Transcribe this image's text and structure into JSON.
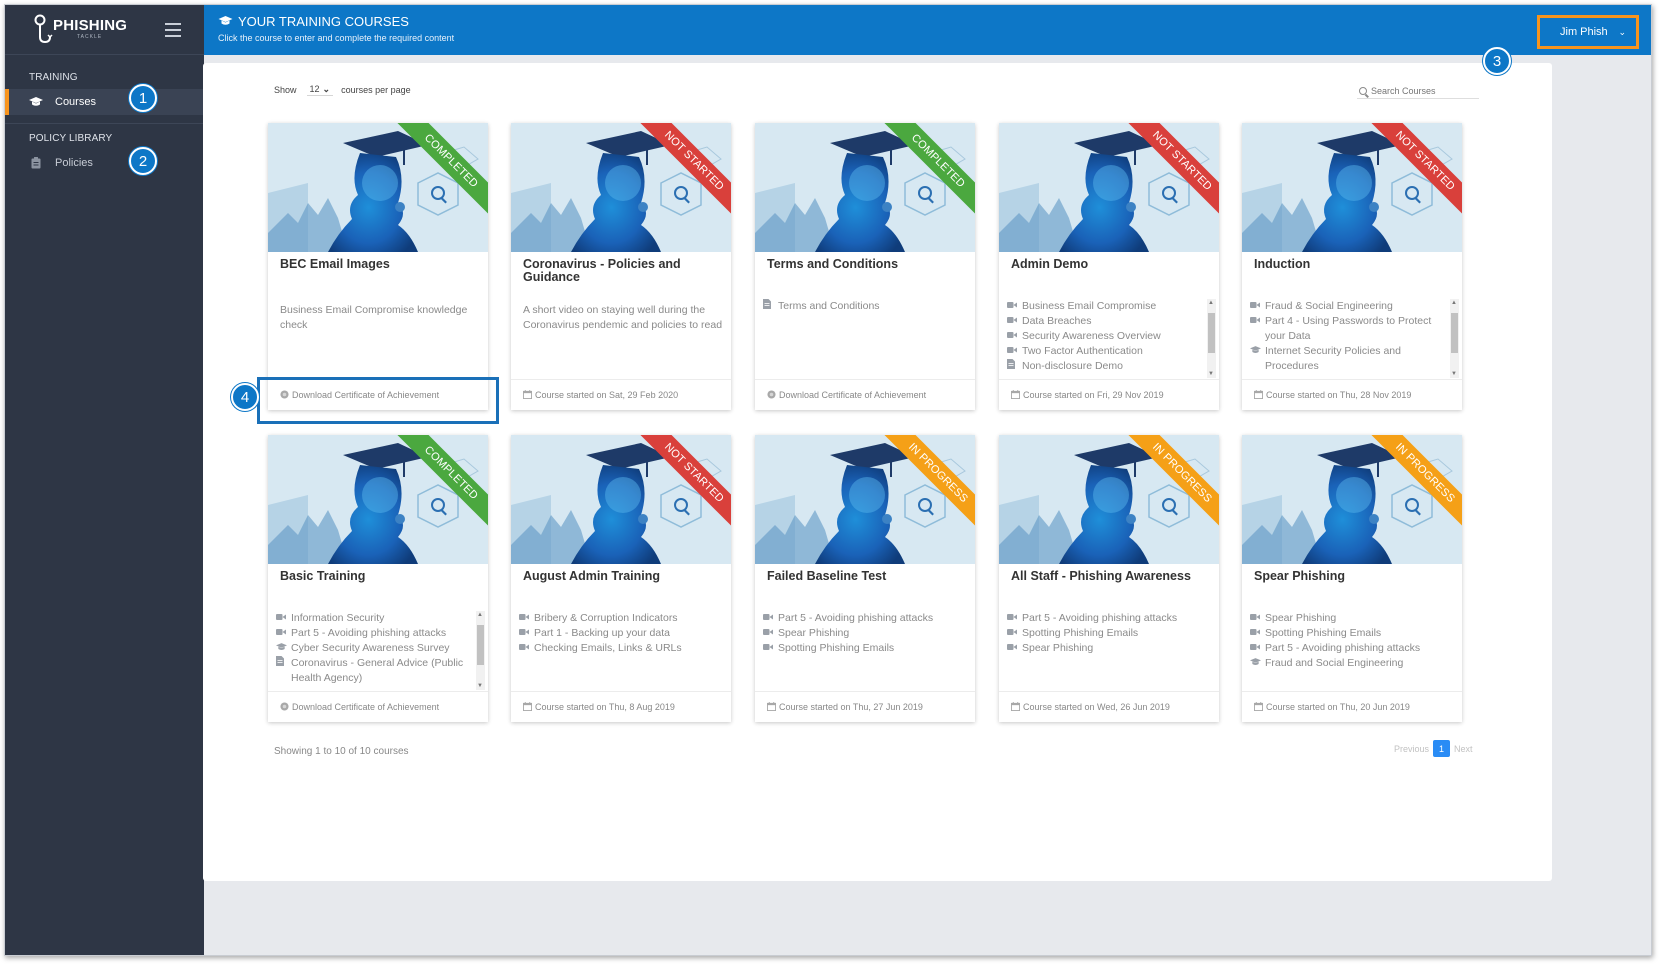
{
  "app": {
    "logo_text": "PHISHING",
    "logo_sub": "TACKLE"
  },
  "sidebar": {
    "sections": [
      {
        "label": "TRAINING",
        "items": [
          {
            "label": "Courses",
            "icon": "graduation-cap-icon",
            "active": true
          }
        ]
      },
      {
        "label": "POLICY LIBRARY",
        "items": [
          {
            "label": "Policies",
            "icon": "clipboard-icon",
            "active": false
          }
        ]
      }
    ]
  },
  "header": {
    "title": "YOUR TRAINING COURSES",
    "subtitle": "Click the course to enter and complete the required content",
    "user": "Jim Phish"
  },
  "callouts": [
    "1",
    "2",
    "3",
    "4"
  ],
  "toolbar": {
    "show_label": "Show",
    "per_page_value": "12",
    "per_page_suffix": "courses per page",
    "search_placeholder": "Search Courses"
  },
  "colors": {
    "completed": "#4ba83f",
    "not_started": "#d9403b",
    "in_progress": "#f5a017",
    "accent": "#0d77c7",
    "sidebar": "#2e3645"
  },
  "courses": [
    {
      "title": "BEC Email Images",
      "status": "COMPLETED",
      "description": "Business Email Compromise knowledge check",
      "items": [],
      "footer": "Download Certificate of Achievement",
      "footer_icon": "award-icon",
      "scroll": false
    },
    {
      "title": "Coronavirus - Policies and Guidance",
      "status": "NOT STARTED",
      "description": "A short video on staying well during the Coronavirus pendemic and policies to read",
      "items": [],
      "footer": "Course started on Sat, 29 Feb 2020",
      "footer_icon": "calendar-icon",
      "scroll": false
    },
    {
      "title": "Terms and Conditions",
      "status": "COMPLETED",
      "description": "",
      "items": [
        {
          "icon": "document-icon",
          "text": "Terms and Conditions"
        }
      ],
      "footer": "Download Certificate of Achievement",
      "footer_icon": "award-icon",
      "scroll": false
    },
    {
      "title": "Admin Demo",
      "status": "NOT STARTED",
      "description": "",
      "items": [
        {
          "icon": "video-icon",
          "text": "Business Email Compromise"
        },
        {
          "icon": "video-icon",
          "text": "Data Breaches"
        },
        {
          "icon": "video-icon",
          "text": "Security Awareness Overview"
        },
        {
          "icon": "video-icon",
          "text": "Two Factor Authentication"
        },
        {
          "icon": "document-icon",
          "text": "Non-disclosure Demo"
        }
      ],
      "footer": "Course started on Fri, 29 Nov 2019",
      "footer_icon": "calendar-icon",
      "scroll": true
    },
    {
      "title": "Induction",
      "status": "NOT STARTED",
      "description": "",
      "items": [
        {
          "icon": "video-icon",
          "text": "Fraud & Social Engineering"
        },
        {
          "icon": "video-icon",
          "text": "Part 4 - Using Passwords to Protect your Data"
        },
        {
          "icon": "graduation-cap-icon",
          "text": "Internet Security Policies and Procedures"
        }
      ],
      "footer": "Course started on Thu, 28 Nov 2019",
      "footer_icon": "calendar-icon",
      "scroll": true
    },
    {
      "title": "Basic Training",
      "status": "COMPLETED",
      "description": "",
      "items": [
        {
          "icon": "video-icon",
          "text": "Information Security"
        },
        {
          "icon": "video-icon",
          "text": "Part 5 - Avoiding phishing attacks"
        },
        {
          "icon": "graduation-cap-icon",
          "text": "Cyber Security Awareness Survey"
        },
        {
          "icon": "document-icon",
          "text": "Coronavirus - General Advice (Public Health Agency)"
        }
      ],
      "footer": "Download Certificate of Achievement",
      "footer_icon": "award-icon",
      "scroll": true
    },
    {
      "title": "August Admin Training",
      "status": "NOT STARTED",
      "description": "",
      "items": [
        {
          "icon": "video-icon",
          "text": "Bribery & Corruption Indicators"
        },
        {
          "icon": "video-icon",
          "text": "Part 1 - Backing up your data"
        },
        {
          "icon": "video-icon",
          "text": "Checking Emails, Links & URLs"
        }
      ],
      "footer": "Course started on Thu, 8 Aug 2019",
      "footer_icon": "calendar-icon",
      "scroll": false
    },
    {
      "title": "Failed Baseline Test",
      "status": "IN PROGRESS",
      "description": "",
      "items": [
        {
          "icon": "video-icon",
          "text": "Part 5 - Avoiding phishing attacks"
        },
        {
          "icon": "video-icon",
          "text": "Spear Phishing"
        },
        {
          "icon": "video-icon",
          "text": "Spotting Phishing Emails"
        }
      ],
      "footer": "Course started on Thu, 27 Jun 2019",
      "footer_icon": "calendar-icon",
      "scroll": false
    },
    {
      "title": "All Staff - Phishing Awareness",
      "status": "IN PROGRESS",
      "description": "",
      "items": [
        {
          "icon": "video-icon",
          "text": "Part 5 - Avoiding phishing attacks"
        },
        {
          "icon": "video-icon",
          "text": "Spotting Phishing Emails"
        },
        {
          "icon": "video-icon",
          "text": "Spear Phishing"
        }
      ],
      "footer": "Course started on Wed, 26 Jun 2019",
      "footer_icon": "calendar-icon",
      "scroll": false
    },
    {
      "title": "Spear Phishing",
      "status": "IN PROGRESS",
      "description": "",
      "items": [
        {
          "icon": "video-icon",
          "text": "Spear Phishing"
        },
        {
          "icon": "video-icon",
          "text": "Spotting Phishing Emails"
        },
        {
          "icon": "video-icon",
          "text": "Part 5 - Avoiding phishing attacks"
        },
        {
          "icon": "graduation-cap-icon",
          "text": "Fraud and Social Engineering"
        }
      ],
      "footer": "Course started on Thu, 20 Jun 2019",
      "footer_icon": "calendar-icon",
      "scroll": false
    }
  ],
  "footer": {
    "showing": "Showing 1 to 10 of 10 courses",
    "previous": "Previous",
    "page": "1",
    "next": "Next"
  }
}
